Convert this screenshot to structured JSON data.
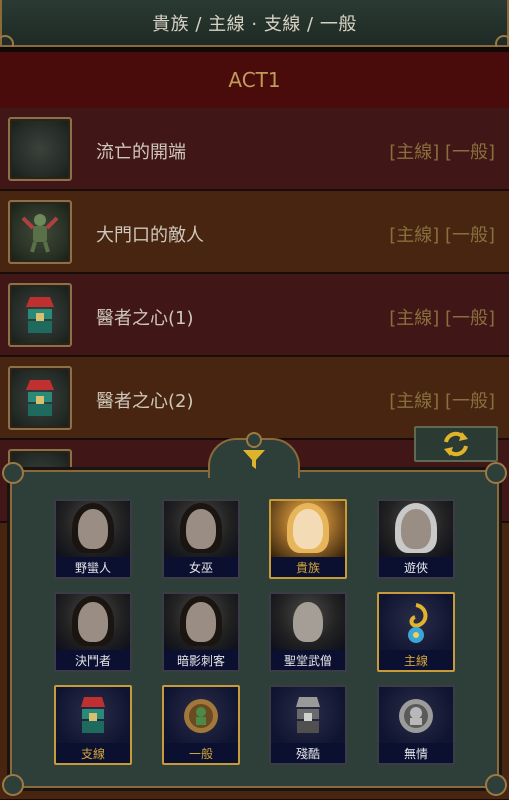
{
  "header": {
    "title": "貴族 / 主線 · 支線 / 一般"
  },
  "act": {
    "label": "ACT1"
  },
  "quests": [
    {
      "name": "流亡的開端",
      "tags": "[主線] [一般]",
      "icon": "blank-map-icon"
    },
    {
      "name": "大門口的敵人",
      "tags": "[主線] [一般]",
      "icon": "zombie-icon"
    },
    {
      "name": "醫者之心(1)",
      "tags": "[主線] [一般]",
      "icon": "potion-chest-icon"
    },
    {
      "name": "醫者之心(2)",
      "tags": "[主線] [一般]",
      "icon": "potion-chest-icon"
    }
  ],
  "refresh_icon": "refresh-icon",
  "filter_icon": "funnel-icon",
  "filters": [
    {
      "label": "野蠻人",
      "selected": false,
      "icon": "marauder-portrait"
    },
    {
      "label": "女巫",
      "selected": false,
      "icon": "witch-portrait"
    },
    {
      "label": "貴族",
      "selected": true,
      "icon": "scion-portrait"
    },
    {
      "label": "遊俠",
      "selected": false,
      "icon": "ranger-portrait"
    },
    {
      "label": "決鬥者",
      "selected": false,
      "icon": "duelist-portrait"
    },
    {
      "label": "暗影刺客",
      "selected": false,
      "icon": "shadow-portrait"
    },
    {
      "label": "聖堂武僧",
      "selected": false,
      "icon": "templar-portrait"
    },
    {
      "label": "主線",
      "selected": true,
      "icon": "spiral-shell-icon"
    },
    {
      "label": "支線",
      "selected": true,
      "icon": "potion-chest-icon"
    },
    {
      "label": "一般",
      "selected": true,
      "icon": "bronze-coin-icon"
    },
    {
      "label": "殘酷",
      "selected": false,
      "icon": "silver-chest-icon"
    },
    {
      "label": "無情",
      "selected": false,
      "icon": "silver-coin-icon"
    }
  ],
  "colors": {
    "accent_gold": "#c79a3a",
    "act_bg": "#4a0b0b",
    "panel_bg": "#2e3e38"
  }
}
